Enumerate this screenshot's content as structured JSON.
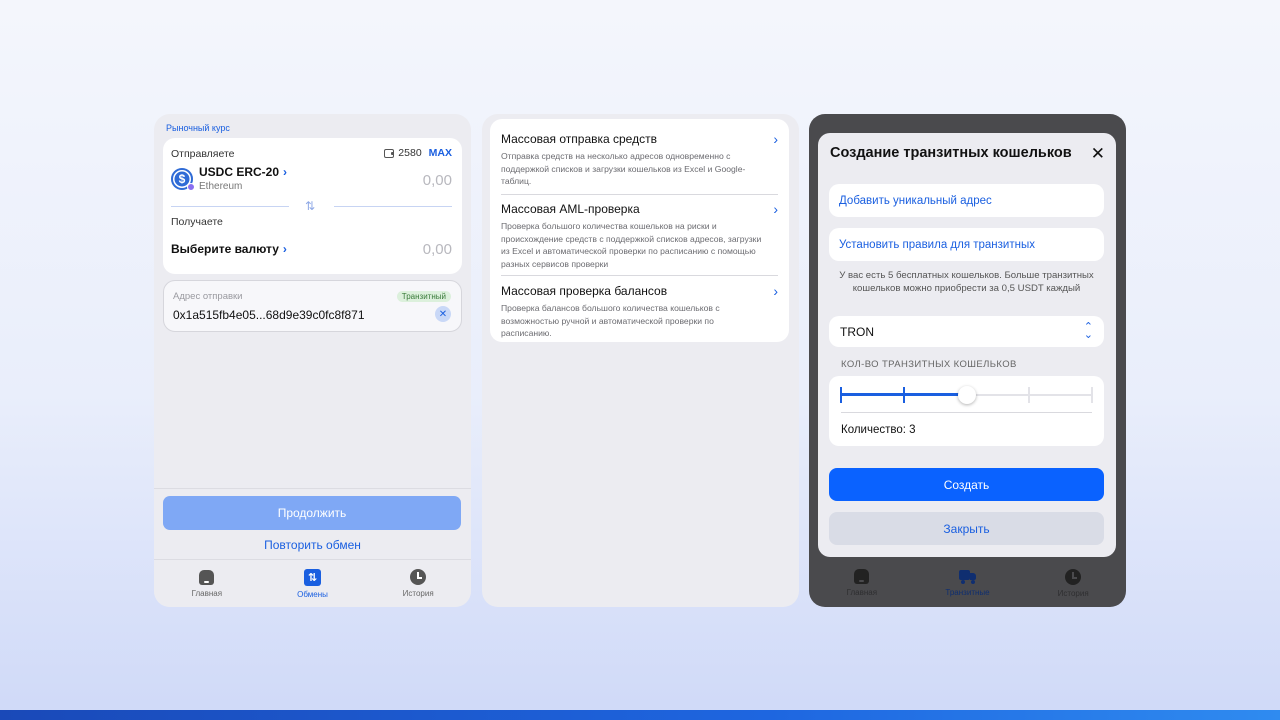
{
  "screen1": {
    "rate_label": "Рыночный курс",
    "send_label": "Отправляете",
    "balance": "2580",
    "max_label": "MAX",
    "coin_name": "USDC ERC-20",
    "coin_network": "Ethereum",
    "send_amount": "0,00",
    "receive_label": "Получаете",
    "choose_currency": "Выберите валюту",
    "receive_amount": "0,00",
    "address_label": "Адрес отправки",
    "transit_badge": "Транзитный",
    "address_value": "0x1a515fb4e05...68d9e39c0fc8f871",
    "continue_button": "Продолжить",
    "repeat_link": "Повторить обмен",
    "tabs": [
      {
        "label": "Главная",
        "icon": "home-icon",
        "active": false
      },
      {
        "label": "Обмены",
        "icon": "exchange-icon",
        "active": true
      },
      {
        "label": "История",
        "icon": "history-icon",
        "active": false
      }
    ]
  },
  "screen2": {
    "items": [
      {
        "title": "Массовая отправка средств",
        "description": "Отправка средств на несколько адресов одновременно с поддержкой списков и загрузки кошельков из Excel и Google-таблиц."
      },
      {
        "title": "Массовая AML-проверка",
        "description": "Проверка большого количества кошельков на риски и происхождение средств с поддержкой списков адресов, загрузки из Excel и автоматической проверки по расписанию с помощью разных сервисов проверки"
      },
      {
        "title": "Массовая проверка балансов",
        "description": "Проверка балансов большого количества кошельков с возможностью ручной и автоматической проверки по расписанию."
      }
    ]
  },
  "screen3": {
    "modal_title": "Создание транзитных кошельков",
    "add_unique_address": "Добавить уникальный адрес",
    "set_rules": "Установить правила для транзитных",
    "info_text": "У вас есть 5 бесплатных кошельков. Больше транзитных кошельков можно приобрести за 0,5 USDT каждый",
    "network": "TRON",
    "quantity_section": "КОЛ-ВО ТРАНЗИТНЫХ КОШЕЛЬКОВ",
    "quantity_label": "Количество: 3",
    "slider_min": 1,
    "slider_max": 5,
    "slider_value": 3,
    "create_button": "Создать",
    "close_button": "Закрыть",
    "tabs": [
      {
        "label": "Главная",
        "icon": "home-icon",
        "active": false
      },
      {
        "label": "Транзитные",
        "icon": "truck-icon",
        "active": true
      },
      {
        "label": "История",
        "icon": "history-icon",
        "active": false
      }
    ]
  },
  "colors": {
    "accent": "#1a5fe0",
    "primary_button": "#0a62ff",
    "disabled_button": "#7fa8f5",
    "transit_badge_bg": "#dcf0dc"
  }
}
